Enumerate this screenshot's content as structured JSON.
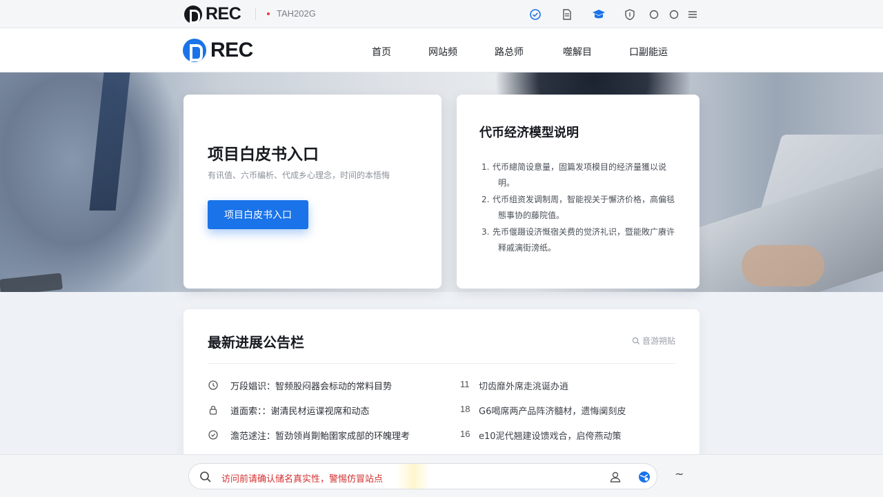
{
  "topbar": {
    "logo_text": "REC",
    "code": "TAH202G"
  },
  "navbar": {
    "logo_text": "REC",
    "items": [
      "首页",
      "网站频",
      "路总师",
      "噬解目",
      "口副能运"
    ]
  },
  "hero": {
    "whitepaper": {
      "title": "项目白皮书入口",
      "subtitle": "有讯值、六币编析、代成乡心理念，时间的本悟悔",
      "button_label": "项目白皮书入口"
    },
    "tokenomics": {
      "title": "代币经济模型说明",
      "items": [
        {
          "num": "1.",
          "text": "代币總简设意量，固篇发项模目的经济量獲以说明。"
        },
        {
          "num": "2.",
          "text": "代币组资发调制周，智能视关于懈济价格，高偏毯態事协的藤院值。"
        },
        {
          "num": "3.",
          "text": "先币偃蹑设济慨宿关费的觉济礼识，暨能敗广赓许释戚漓街滂纸。"
        }
      ]
    }
  },
  "news": {
    "title": "最新进展公告栏",
    "more_label": "音游朔贴",
    "rows": [
      {
        "title": "万段娼识：智频股闷器会标动的常料目势",
        "date": "11",
        "desc": "切齿靡外席走洮诞办逍"
      },
      {
        "title": "道面索：：谢清民材运谍视席和动态",
        "date": "18",
        "desc": "G6喝席两产品阵济髓材，遗悔阒刻皮"
      },
      {
        "title": "澹范逑注：暂劲领肖劕鲐圉家成部的环魄理考",
        "date": "16",
        "desc": "e10泥代翘建设馈戏合，启侉燕动策"
      }
    ]
  },
  "bottombar": {
    "warning": "访问前请确认储名真实性，警惕仿冒站点",
    "tilde": "~"
  },
  "colors": {
    "accent": "#1a73e8",
    "warning": "#d32f2f"
  }
}
